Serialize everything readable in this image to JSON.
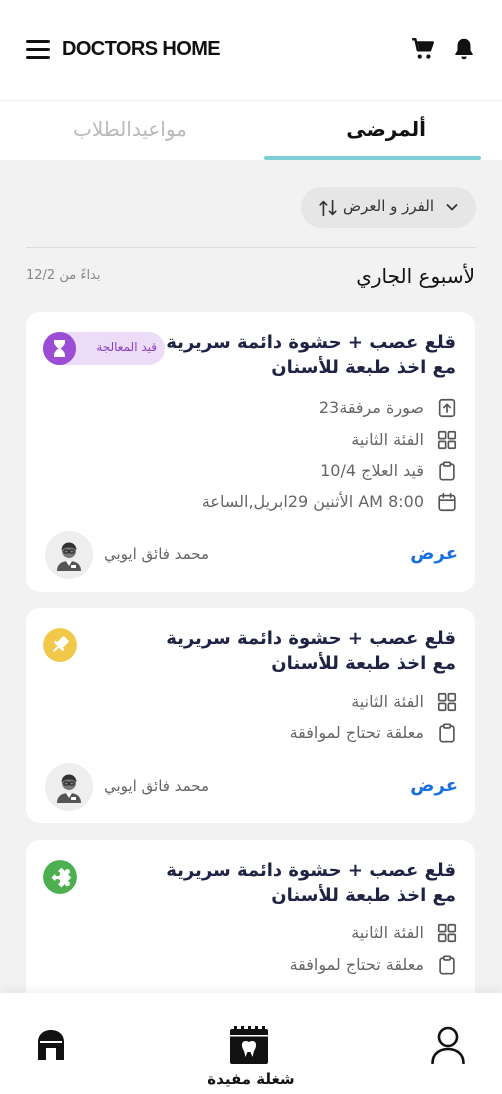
{
  "header": {
    "logo": "DOCTORS HOME",
    "menu_icon": "hamburger-menu-icon",
    "cart_icon": "cart-icon",
    "bell_icon": "bell-icon"
  },
  "tabs": {
    "patients": "ألمرضى",
    "students": "مواعيدالطلاب",
    "active": "patients",
    "accent": "#7fd0d4"
  },
  "sort": {
    "label": "الفرز و العرض"
  },
  "section": {
    "title": "لأسبوع الجاري",
    "since": "بداءً من 12/2"
  },
  "cards": [
    {
      "title": "قلع عصب + حشوة دائمة سريرية مع اخذ طبعة للأسنان",
      "status": "قيد المعالجة",
      "attachments": "23صورة مرفقة",
      "category": "الفئة الثانية",
      "treatment": "قيد العلاج 10/4",
      "datetime": "الأثنين 29ابريل,الساعة AM 8:00",
      "doctor": "محمد فائق ايوبي",
      "view": "عرض"
    },
    {
      "title": "قلع عصب + حشوة دائمة سريرية مع اخذ طبعة للأسنان",
      "status_icon": "pin-icon",
      "status_color": "#f2c84b",
      "category": "الفئة الثانية",
      "pending": "معلقة تحتاج لموافقة",
      "doctor": "محمد فائق ايوبي",
      "view": "عرض"
    },
    {
      "title": "قلع عصب + حشوة دائمة سريرية مع اخذ طبعة للأسنان",
      "status_icon": "puzzle-icon",
      "status_color": "#4caf50",
      "category": "الفئة الثانية",
      "pending": "معلقة تحتاج لموافقة"
    }
  ],
  "bottom_nav": {
    "home_icon": "home-icon",
    "useful": "شغلة مفيدة",
    "profile_icon": "profile-icon"
  }
}
